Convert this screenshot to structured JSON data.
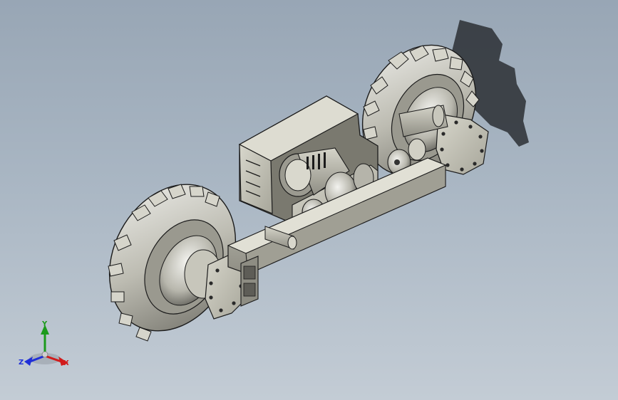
{
  "viewport": {
    "background_top": "#98a6b5",
    "background_bottom": "#c3ccd5"
  },
  "model": {
    "body_color": "#c9c8bd",
    "edge_color": "#1b1b1b",
    "shadow_color": "#2b2f34",
    "parts": [
      "wheel-rear",
      "wheel-front",
      "gearbox",
      "motor",
      "square-tube-frame",
      "hub-plates",
      "drive-shaft",
      "coupling"
    ]
  },
  "triad": {
    "y_label": "Y",
    "x_label": "X",
    "z_label": "Z",
    "y_color": "#1c9a1c",
    "x_color": "#d11b1b",
    "z_color": "#1f2fd8"
  }
}
